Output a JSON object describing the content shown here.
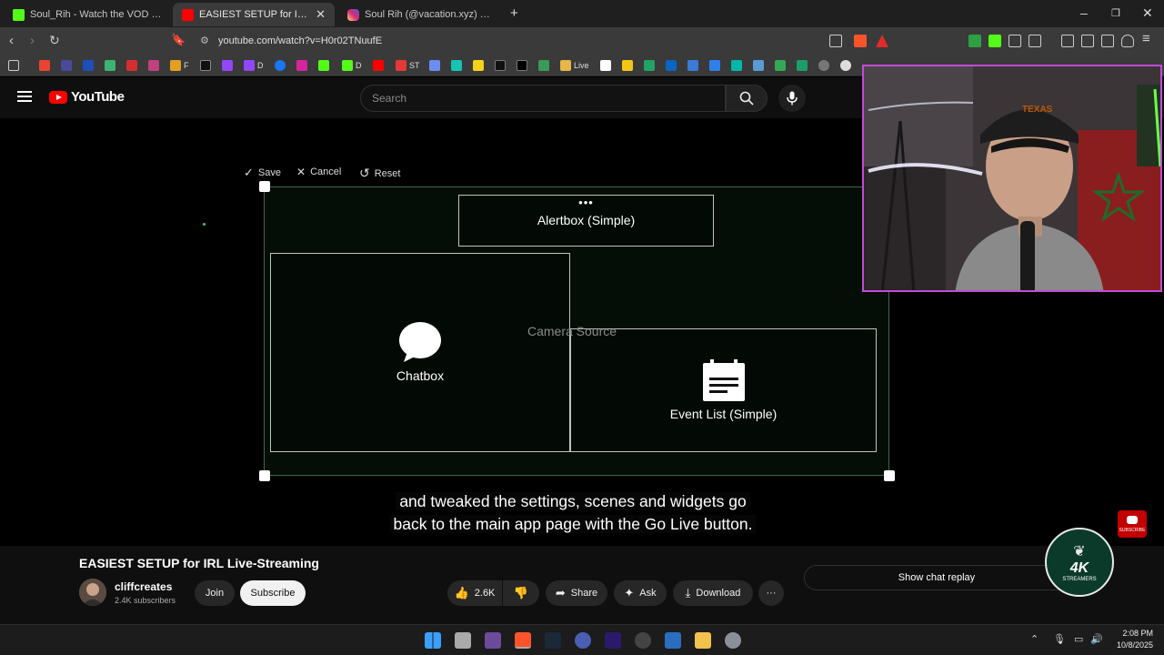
{
  "browser": {
    "tabs": [
      {
        "title": "Soul_Rih - Watch the VOD on Kick",
        "favicon_color": "#53fc18"
      },
      {
        "title": "EASIEST SETUP for IRL Live-St...",
        "favicon_color": "#ff0000"
      },
      {
        "title": "Soul Rih (@vacation.xyz) · Instagram",
        "favicon_color": "#d6249f"
      }
    ],
    "new_tab": "+",
    "url": "youtube.com/watch?v=H0r02TNuufE",
    "bookmarks": [
      "F",
      "D",
      "D",
      "ST",
      "Live"
    ]
  },
  "youtube": {
    "logo": "YouTube",
    "search_placeholder": "Search"
  },
  "video": {
    "toolbar": {
      "save": "Save",
      "cancel": "Cancel",
      "reset": "Reset"
    },
    "widgets": {
      "alertbox": "Alertbox (Simple)",
      "chatbox": "Chatbox",
      "camera": "Camera Source",
      "eventlist": "Event List (Simple)"
    },
    "captions": [
      "and tweaked the settings, scenes and widgets go",
      "back to the main app page with the Go Live button."
    ],
    "accent": "#c24bd8"
  },
  "below": {
    "title": "EASIEST SETUP for IRL Live-Streaming",
    "channel": "cliffcreates",
    "subscribers": "2.4K subscribers",
    "join": "Join",
    "subscribe": "Subscribe",
    "likes": "2.6K",
    "share": "Share",
    "ask": "Ask",
    "download": "Download",
    "more": "···",
    "chat_replay": "Show chat replay",
    "brand_logo_text": "4K",
    "brand_logo_sub": "STREAMERS",
    "yt_subscribe_badge": "SUBSCRIBE"
  },
  "taskbar": {
    "time": "2:08 PM",
    "date": "10/8/2025"
  }
}
